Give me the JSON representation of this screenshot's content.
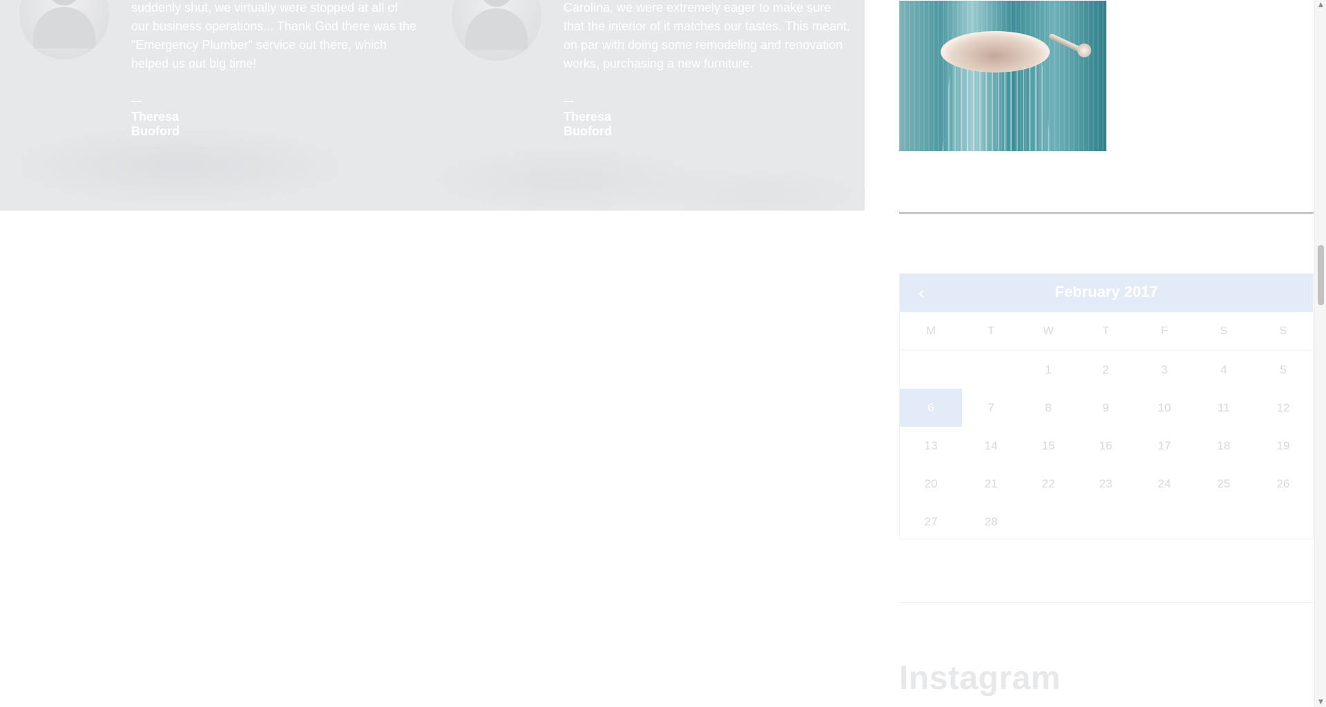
{
  "testimonials": [
    {
      "quote": "suddenly shut, we virtually were stopped at all of our business operations... Thank God there was the \"Emergency Plumber\" service out there, which helped us out big time!",
      "author": "Theresa Buoford"
    },
    {
      "quote": "Carolina, we were extremely eager to make sure that the interior of it matches our tastes. This meant, on par with doing some remodeling and renovation works, purchasing a new furniture.",
      "author": "Theresa Buoford"
    }
  ],
  "calendar": {
    "title": "February 2017",
    "prev_icon": "chevron-left-icon",
    "weekdays": [
      "M",
      "T",
      "W",
      "T",
      "F",
      "S",
      "S"
    ],
    "today": 6,
    "weeks": [
      [
        "",
        "",
        "1",
        "2",
        "3",
        "4",
        "5"
      ],
      [
        "6",
        "7",
        "8",
        "9",
        "10",
        "11",
        "12"
      ],
      [
        "13",
        "14",
        "15",
        "16",
        "17",
        "18",
        "19"
      ],
      [
        "20",
        "21",
        "22",
        "23",
        "24",
        "25",
        "26"
      ],
      [
        "27",
        "28",
        "",
        "",
        "",
        "",
        ""
      ]
    ]
  },
  "instagram": {
    "title": "Instagram"
  },
  "colors": {
    "band_bg": "#e7e8ea",
    "calendar_accent": "#e3ecf6"
  }
}
